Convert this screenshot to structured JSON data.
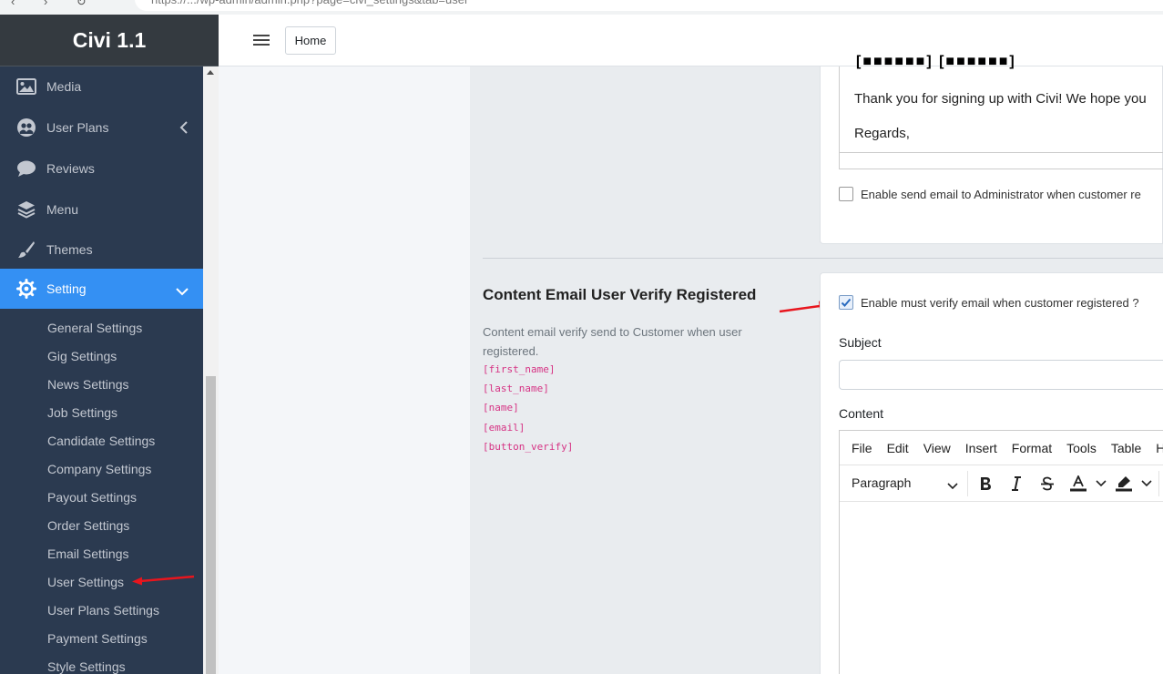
{
  "browser": {
    "url": "https://.../wp-admin/admin.php?page=civi_settings&tab=user"
  },
  "sidebar": {
    "brand": "Civi 1.1",
    "items": [
      {
        "label": "Media",
        "icon": "image-icon"
      },
      {
        "label": "User Plans",
        "icon": "users-icon"
      },
      {
        "label": "Reviews",
        "icon": "comment-icon"
      },
      {
        "label": "Menu",
        "icon": "layers-icon"
      },
      {
        "label": "Themes",
        "icon": "brush-icon"
      },
      {
        "label": "Setting",
        "icon": "gear-icon",
        "active": true
      }
    ],
    "sub_items": [
      "General Settings",
      "Gig Settings",
      "News Settings",
      "Job Settings",
      "Candidate Settings",
      "Company Settings",
      "Payout Settings",
      "Order Settings",
      "Email Settings",
      "User Settings",
      "User Plans Settings",
      "Payment Settings",
      "Style Settings"
    ]
  },
  "topbar": {
    "home_label": "Home"
  },
  "top_card": {
    "email_line1": "Thank you for signing up with Civi! We hope you",
    "email_line2": "Regards,",
    "admin_checkbox_label": "Enable send email to Administrator when customer re",
    "admin_checkbox_checked": false
  },
  "section": {
    "title": "Content Email User Verify Registered",
    "description": "Content email verify send to Customer when user registered.",
    "placeholders": [
      "[first_name]",
      "[last_name]",
      "[name]",
      "[email]",
      "[button_verify]"
    ]
  },
  "main_card": {
    "verify_checkbox_label": "Enable must verify email when customer registered ?",
    "verify_checkbox_checked": true,
    "subject_label": "Subject",
    "subject_value": "",
    "content_label": "Content",
    "editor_menu": [
      "File",
      "Edit",
      "View",
      "Insert",
      "Format",
      "Tools",
      "Table",
      "He"
    ],
    "block_format": "Paragraph"
  },
  "colors": {
    "sidebar_bg": "#2b3a50",
    "active_item": "#3490f3",
    "annotation_arrow": "#e8151d",
    "code_text": "#d63384"
  }
}
